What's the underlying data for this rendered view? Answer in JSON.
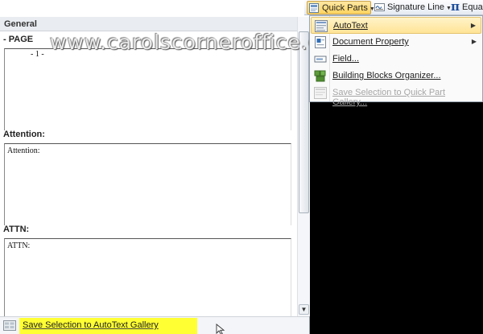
{
  "watermark": "www.carolscorneroffice.com",
  "gallery": {
    "category": "General",
    "entries": [
      {
        "name": "PAGE",
        "preview_text": "- 1 -"
      },
      {
        "name": "Attention:",
        "preview_text": "Attention:"
      },
      {
        "name": "ATTN:",
        "preview_text": "ATTN:"
      }
    ],
    "footer_label": "Save Selection to AutoText Gallery"
  },
  "ribbon": {
    "quick_parts": "Quick Parts",
    "signature_line": "Signature Line",
    "equation": "Equa"
  },
  "menu": {
    "items": [
      {
        "label": "AutoText",
        "has_submenu": true,
        "state": "highlighted"
      },
      {
        "label": "Document Property",
        "has_submenu": true,
        "state": "normal"
      },
      {
        "label": "Field...",
        "has_submenu": false,
        "state": "normal"
      },
      {
        "label": "Building Blocks Organizer...",
        "has_submenu": false,
        "state": "normal"
      },
      {
        "label": "Save Selection to Quick Part Gallery...",
        "has_submenu": false,
        "state": "disabled"
      }
    ]
  },
  "colors": {
    "highlight": "#ffff33",
    "menu_hover": "#ffe497",
    "background": "#000000"
  }
}
